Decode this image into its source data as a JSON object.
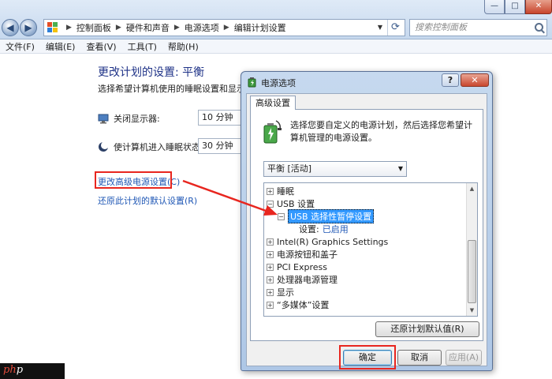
{
  "window_controls": {
    "minimize": "—",
    "maximize": "□",
    "close": "✕"
  },
  "nav": {
    "back": "◀",
    "forward": "▶"
  },
  "address": {
    "crumbs": [
      "控制面板",
      "硬件和声音",
      "电源选项",
      "编辑计划设置"
    ]
  },
  "search": {
    "placeholder": "搜索控制面板"
  },
  "menu": [
    "文件(F)",
    "编辑(E)",
    "查看(V)",
    "工具(T)",
    "帮助(H)"
  ],
  "page": {
    "title": "更改计划的设置: 平衡",
    "description": "选择希望计算机使用的睡眠设置和显示设置。",
    "settings": [
      {
        "label": "关闭显示器:",
        "value": "10 分钟"
      },
      {
        "label": "使计算机进入睡眠状态:",
        "value": "30 分钟"
      }
    ],
    "links": {
      "advanced": "更改高级电源设置(C)",
      "restore": "还原此计划的默认设置(R)"
    }
  },
  "dialog": {
    "title": "电源选项",
    "help": "?",
    "close": "✕",
    "tab": "高级设置",
    "description": "选择您要自定义的电源计划，然后选择您希望计算机管理的电源设置。",
    "plan": "平衡 [活动]",
    "tree": [
      {
        "label": "睡眠",
        "exp": "+",
        "indent": 0
      },
      {
        "label": "USB 设置",
        "exp": "−",
        "indent": 0
      },
      {
        "label": "USB 选择性暂停设置",
        "exp": "−",
        "indent": 1,
        "selected": true
      },
      {
        "label": "设置:",
        "value": "已启用",
        "indent": 2
      },
      {
        "label": "Intel(R) Graphics Settings",
        "exp": "+",
        "indent": 0
      },
      {
        "label": "电源按钮和盖子",
        "exp": "+",
        "indent": 0
      },
      {
        "label": "PCI Express",
        "exp": "+",
        "indent": 0
      },
      {
        "label": "处理器电源管理",
        "exp": "+",
        "indent": 0
      },
      {
        "label": "显示",
        "exp": "+",
        "indent": 0
      },
      {
        "label": "“多媒体”设置",
        "exp": "+",
        "indent": 0
      }
    ],
    "restore_button": "还原计划默认值(R)",
    "ok_button": "确定",
    "cancel_button": "取消",
    "apply_button": "应用(A)"
  },
  "watermark": {
    "text_a": "ph",
    "text_b": "p"
  },
  "colors": {
    "link": "#1f57b5",
    "title": "#1e3287",
    "highlight": "#e8261f",
    "selection": "#3399ff"
  }
}
